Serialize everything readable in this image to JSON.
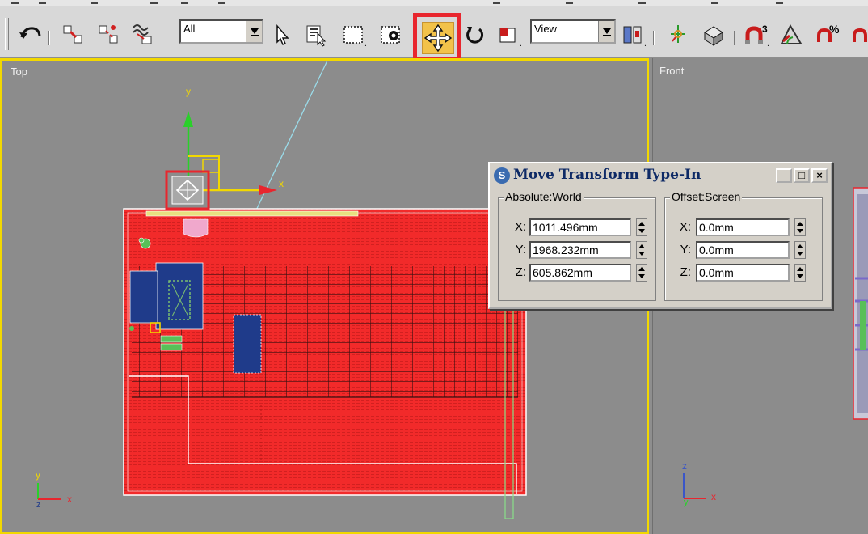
{
  "toolbar": {
    "selection_filter": "All",
    "reference_coordinate_system": "View"
  },
  "viewports": {
    "top_label": "Top",
    "front_label": "Front",
    "axis_x": "x",
    "axis_y": "y",
    "axis_z": "z"
  },
  "dialog": {
    "title": "Move Transform Type-In",
    "icon_glyph": "S",
    "minimize_glyph": "_",
    "restore_glyph": "□",
    "close_glyph": "×",
    "absolute": {
      "title": "Absolute:World",
      "x_label": "X:",
      "x_value": "1011.496mm",
      "y_label": "Y:",
      "y_value": "1968.232mm",
      "z_label": "Z:",
      "z_value": "605.862mm"
    },
    "offset": {
      "title": "Offset:Screen",
      "x_label": "X:",
      "x_value": "0.0mm",
      "y_label": "Y:",
      "y_value": "0.0mm",
      "z_label": "Z:",
      "z_value": "0.0mm"
    }
  },
  "colors": {
    "active_viewport_border": "#f2d800",
    "highlight": "#e8262e",
    "move_button_fill": "#f2c24a",
    "floor_red": "#f22a2a",
    "furniture_blue": "#1f3b8a"
  }
}
